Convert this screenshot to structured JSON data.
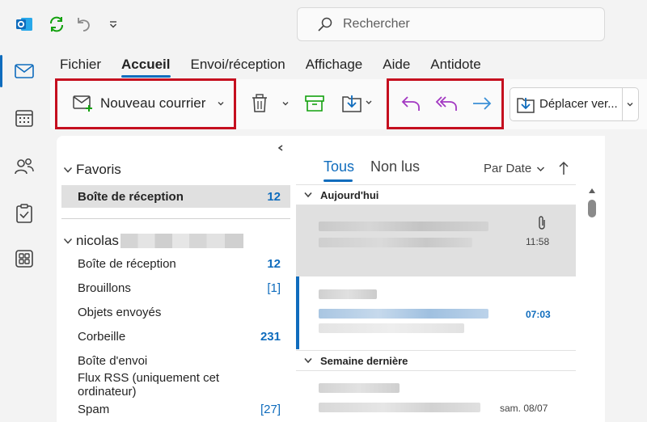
{
  "app": {
    "brand_color": "#0f6cbd",
    "accent_red": "#c50f1f",
    "action_purple": "#a238c2",
    "action_blue": "#3a8fd6"
  },
  "titlebar": {
    "icons": [
      "outlook-logo-icon",
      "sync-icon",
      "undo-icon",
      "customize-quick-access-icon"
    ],
    "search": {
      "placeholder": "Rechercher"
    }
  },
  "rail": {
    "items": [
      "mail-icon",
      "calendar-icon",
      "people-icon",
      "tasks-icon",
      "apps-icon"
    ],
    "active": "mail-icon"
  },
  "menu": {
    "tabs": [
      {
        "label": "Fichier"
      },
      {
        "label": "Accueil",
        "active": true
      },
      {
        "label": "Envoi/réception"
      },
      {
        "label": "Affichage"
      },
      {
        "label": "Aide"
      },
      {
        "label": "Antidote"
      }
    ]
  },
  "ribbon": {
    "new_mail": "Nouveau courrier",
    "move_to": "Déplacer ver...",
    "icons": [
      "new-mail-icon",
      "delete-icon",
      "archive-icon",
      "move-icon",
      "reply-icon",
      "reply-all-icon",
      "forward-icon"
    ]
  },
  "folders": {
    "favorites_label": "Favoris",
    "favorites": [
      {
        "name": "Boîte de réception",
        "count": "12"
      }
    ],
    "account_label": "nicolas",
    "items": [
      {
        "name": "Boîte de réception",
        "count": "12"
      },
      {
        "name": "Brouillons",
        "count": "[1]"
      },
      {
        "name": "Objets envoyés",
        "count": ""
      },
      {
        "name": "Corbeille",
        "count": "231"
      },
      {
        "name": "Boîte d'envoi",
        "count": ""
      },
      {
        "name": "Flux RSS (uniquement cet ordinateur)",
        "count": ""
      },
      {
        "name": "Spam",
        "count": "[27]"
      }
    ]
  },
  "messages": {
    "tabs": [
      "Tous",
      "Non lus"
    ],
    "active_tab": "Tous",
    "sort_label": "Par Date",
    "groups": [
      {
        "label": "Aujourd'hui",
        "items": [
          {
            "time": "11:58",
            "attachment": true,
            "selected": true
          },
          {
            "time": "07:03",
            "unread": true
          }
        ]
      },
      {
        "label": "Semaine dernière",
        "items": [
          {
            "time": "sam. 08/07"
          }
        ]
      }
    ]
  }
}
